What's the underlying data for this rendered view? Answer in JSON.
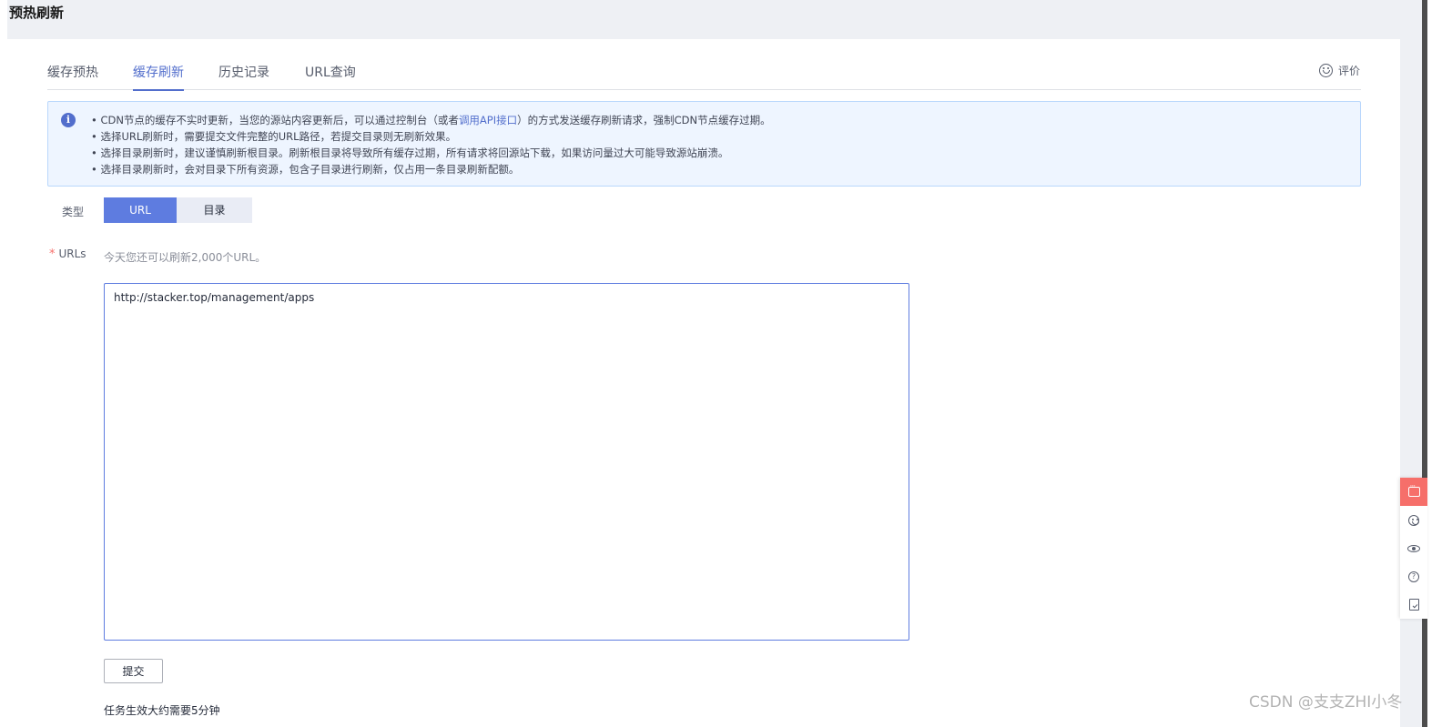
{
  "page": {
    "title": "预热刷新"
  },
  "tabs": [
    {
      "label": "缓存预热",
      "active": false
    },
    {
      "label": "缓存刷新",
      "active": true
    },
    {
      "label": "历史记录",
      "active": false
    },
    {
      "label": "URL查询",
      "active": false
    }
  ],
  "feedback": {
    "label": "评价",
    "icon": "smile-icon"
  },
  "notice": {
    "icon": "info-icon",
    "line1_prefix": "• CDN节点的缓存不实时更新，当您的源站内容更新后，可以通过控制台（或者",
    "line1_link": "调用API接口",
    "line1_suffix": "）的方式发送缓存刷新请求，强制CDN节点缓存过期。",
    "line2": "• 选择URL刷新时，需要提交文件完整的URL路径，若提交目录则无刷新效果。",
    "line3": "• 选择目录刷新时，建议谨慎刷新根目录。刷新根目录将导致所有缓存过期，所有请求将回源站下载，如果访问量过大可能导致源站崩溃。",
    "line4": "• 选择目录刷新时，会对目录下所有资源，包含子目录进行刷新，仅占用一条目录刷新配额。"
  },
  "form": {
    "type_label": "类型",
    "type_options": [
      "URL",
      "目录"
    ],
    "type_selected": "URL",
    "urls_required_mark": "*",
    "urls_label": "URLs",
    "urls_hint": "今天您还可以刷新2,000个URL。",
    "urls_value": "http://stacker.top/management/apps",
    "submit_label": "提交",
    "bottom_note": "任务生效大约需要5分钟"
  },
  "float_tools": [
    "message-icon",
    "smile-icon",
    "eye-icon",
    "help-icon",
    "checklist-icon"
  ],
  "watermark": "CSDN @支支ZHI小冬",
  "colors": {
    "accent": "#5e7ce0",
    "link": "#526ecc",
    "notice_bg": "#eef5ff",
    "required": "#f66f6a",
    "float_active": "#f66f6a"
  }
}
